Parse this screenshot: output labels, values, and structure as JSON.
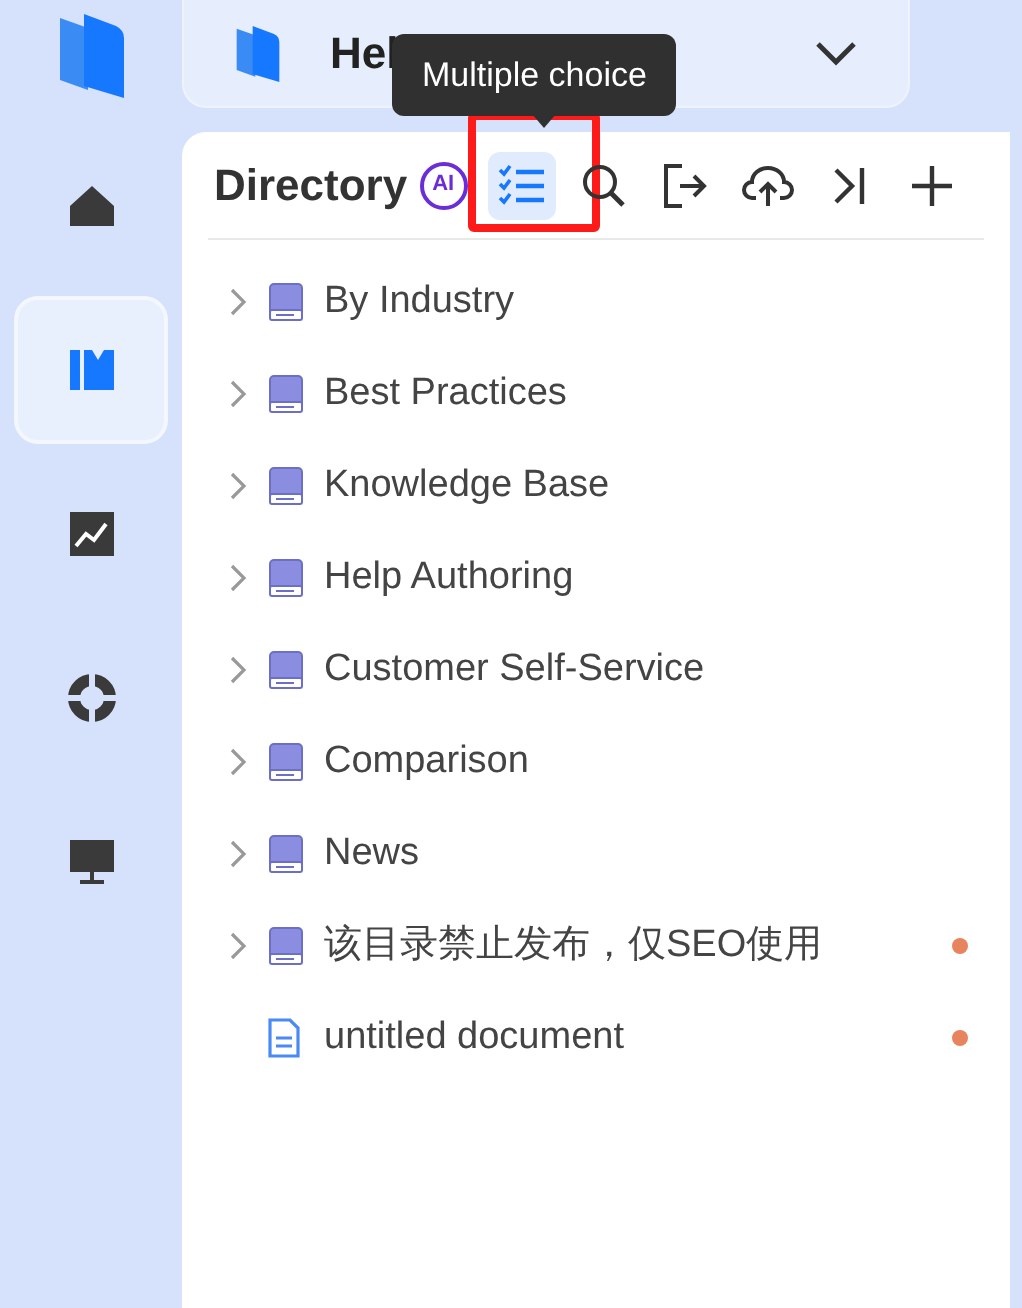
{
  "nav": [
    {
      "selected": false
    },
    {
      "selected": true
    },
    {
      "selected": false
    },
    {
      "selected": false
    },
    {
      "selected": false
    }
  ],
  "workspace": {
    "title": "Hel"
  },
  "tooltip": "Multiple choice",
  "directory": {
    "title": "Directory",
    "ai_badge": "AI",
    "tools": [
      {
        "selected": true,
        "highlighted": true
      },
      {
        "selected": false,
        "highlighted": false
      },
      {
        "selected": false,
        "highlighted": false
      },
      {
        "selected": false,
        "highlighted": false
      },
      {
        "selected": false,
        "highlighted": false
      },
      {
        "selected": false,
        "highlighted": false
      }
    ],
    "items": [
      {
        "kind": "folder",
        "label": "By Industry",
        "unpublished": false
      },
      {
        "kind": "folder",
        "label": "Best Practices",
        "unpublished": false
      },
      {
        "kind": "folder",
        "label": "Knowledge Base",
        "unpublished": false
      },
      {
        "kind": "folder",
        "label": "Help Authoring",
        "unpublished": false
      },
      {
        "kind": "folder",
        "label": "Customer Self-Service",
        "unpublished": false
      },
      {
        "kind": "folder",
        "label": "Comparison",
        "unpublished": false
      },
      {
        "kind": "folder",
        "label": "News",
        "unpublished": false
      },
      {
        "kind": "folder",
        "label": "该目录禁止发布，仅SEO使用",
        "unpublished": true
      },
      {
        "kind": "document",
        "label": "untitled document",
        "unpublished": true
      }
    ]
  }
}
